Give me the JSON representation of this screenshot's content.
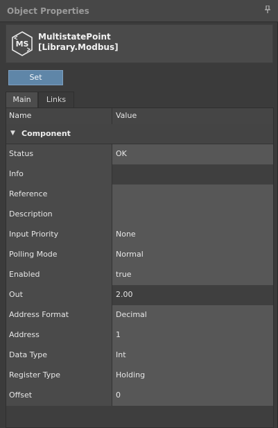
{
  "panel": {
    "title": "Object Properties",
    "pin_icon": "pin-icon"
  },
  "object": {
    "icon": "multistate-point-icon",
    "icon_label": "MS",
    "name_line1": "MultistatePoint",
    "name_line2": "[Library.Modbus]"
  },
  "actions": {
    "set_label": "Set"
  },
  "tabs": [
    {
      "label": "Main",
      "active": true
    },
    {
      "label": "Links",
      "active": false
    }
  ],
  "grid": {
    "columns": [
      "Name",
      "Value"
    ],
    "group": "Component",
    "rows": [
      {
        "name": "Status",
        "value": "OK"
      },
      {
        "name": "Info",
        "value": ""
      },
      {
        "name": "Reference",
        "value": ""
      },
      {
        "name": "Description",
        "value": ""
      },
      {
        "name": "Input Priority",
        "value": "None"
      },
      {
        "name": "Polling Mode",
        "value": "Normal"
      },
      {
        "name": "Enabled",
        "value": "true"
      },
      {
        "name": "Out",
        "value": "2.00"
      },
      {
        "name": "Address Format",
        "value": "Decimal"
      },
      {
        "name": "Address",
        "value": "1"
      },
      {
        "name": "Data Type",
        "value": "Int"
      },
      {
        "name": "Register Type",
        "value": "Holding"
      },
      {
        "name": "Offset",
        "value": "0"
      }
    ]
  },
  "colors": {
    "accent": "#5f86a8",
    "background": "#3b3b3b"
  }
}
